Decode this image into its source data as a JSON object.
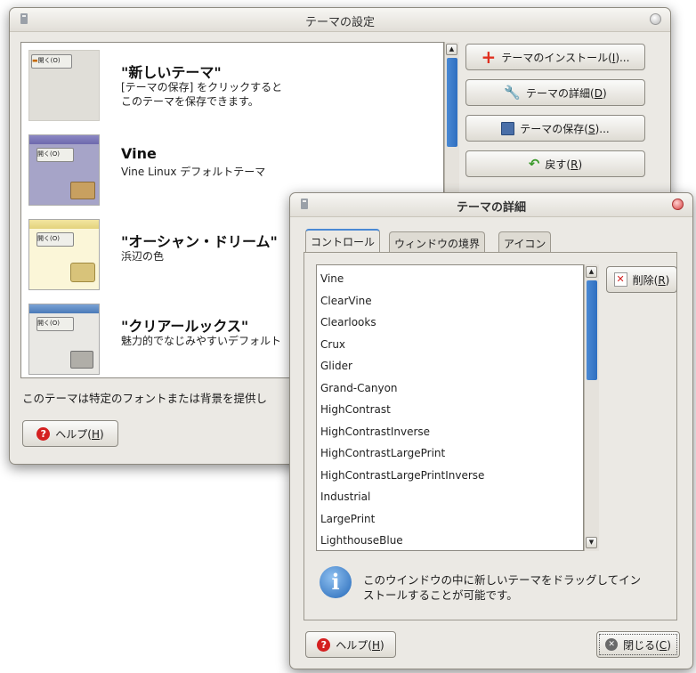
{
  "main_window": {
    "title": "テーマの設定",
    "themes": [
      {
        "name": "\"新しいテーマ\"",
        "desc1": "[テーマの保存] をクリックすると",
        "desc2": "このテーマを保存できます。",
        "preview_button": "開く(O)"
      },
      {
        "name": "Vine",
        "desc1": "Vine Linux デフォルトテーマ",
        "desc2": "",
        "preview_button": "開く(O)"
      },
      {
        "name": "\"オーシャン・ドリーム\"",
        "desc1": "浜辺の色",
        "desc2": "",
        "preview_button": "開く(O)"
      },
      {
        "name": "\"クリアールックス\"",
        "desc1": "魅力的でなじみやすいデフォルト",
        "desc2": "",
        "preview_button": "開く(O)"
      }
    ],
    "buttons": {
      "install": {
        "text": "テーマのインストール(",
        "mn": "I",
        "tail": ")..."
      },
      "details": {
        "text": "テーマの詳細(",
        "mn": "D",
        "tail": ")"
      },
      "save": {
        "text": "テーマの保存(",
        "mn": "S",
        "tail": ")..."
      },
      "revert": {
        "text": "戻す(",
        "mn": "R",
        "tail": ")"
      },
      "help": {
        "text": "ヘルプ(",
        "mn": "H",
        "tail": ")"
      }
    },
    "status_text": "このテーマは特定のフォントまたは背景を提供し"
  },
  "details_dialog": {
    "title": "テーマの詳細",
    "tabs": [
      "コントロール",
      "ウィンドウの境界",
      "アイコン"
    ],
    "active_tab": 0,
    "themes": [
      "Vine",
      "ClearVine",
      "Clearlooks",
      "Crux",
      "Glider",
      "Grand-Canyon",
      "HighContrast",
      "HighContrastInverse",
      "HighContrastLargePrint",
      "HighContrastLargePrintInverse",
      "Industrial",
      "LargePrint",
      "LighthouseBlue"
    ],
    "delete": {
      "text": "削除(",
      "mn": "R",
      "tail": ")"
    },
    "info_line1": "このウインドウの中に新しいテーマをドラッグしてイン",
    "info_line2": "ストールすることが可能です。",
    "help": {
      "text": "ヘルプ(",
      "mn": "H",
      "tail": ")"
    },
    "close": {
      "text": "閉じる(",
      "mn": "C",
      "tail": ")"
    }
  },
  "colors": {
    "accent": "#4a89d4",
    "selection_blue": "#2f6fc0",
    "help_red": "#d42020",
    "install_red": "#e03020",
    "revert_green": "#3a9a2a"
  }
}
